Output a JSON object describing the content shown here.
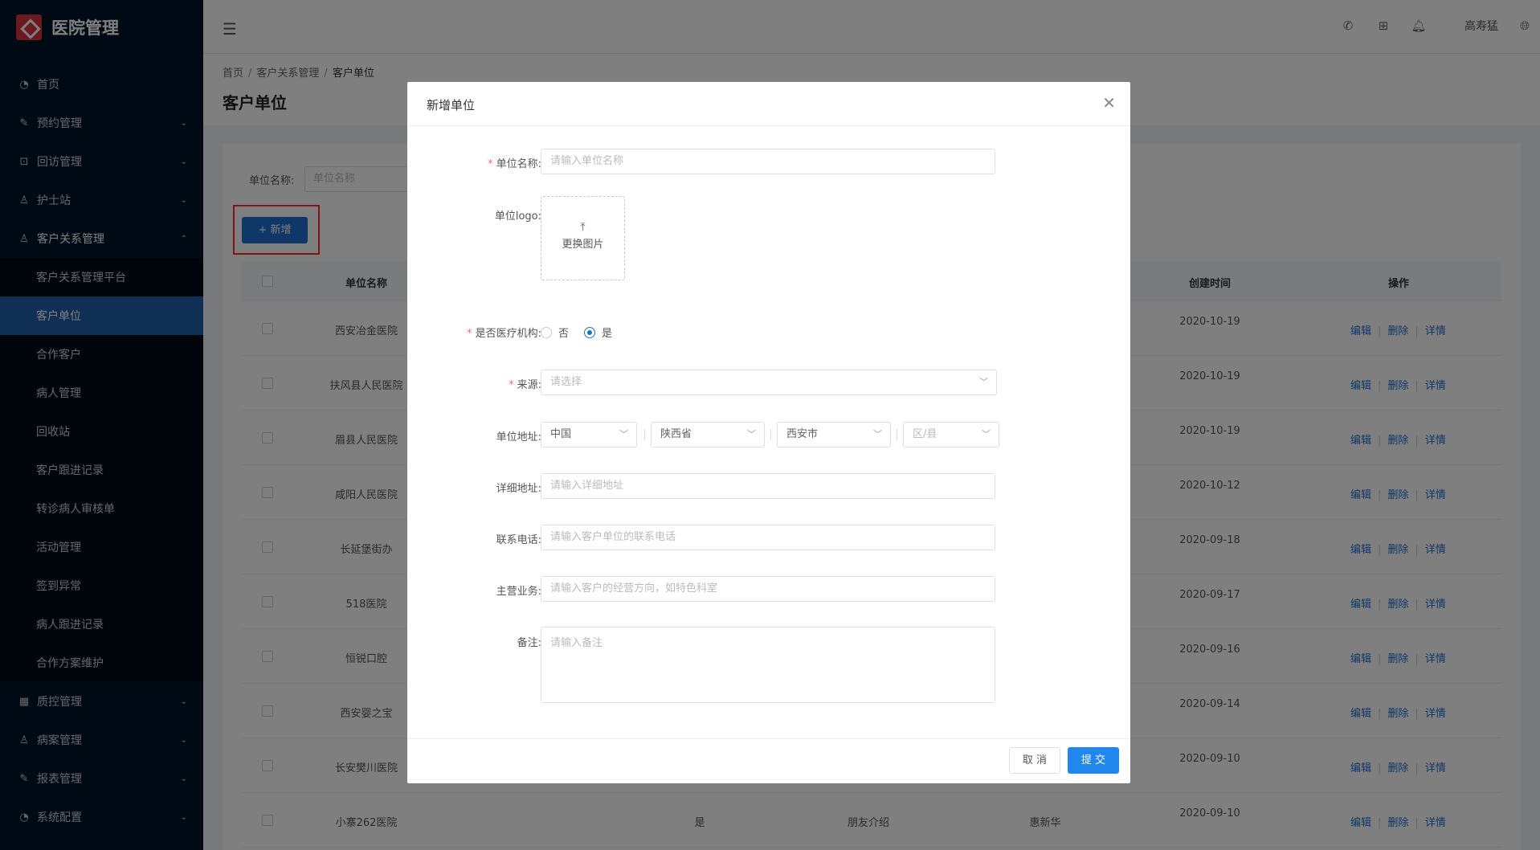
{
  "app": {
    "title": "医院管理"
  },
  "sidebar": {
    "items": [
      {
        "label": "首页",
        "icon": "dashboard-icon",
        "has_children": false
      },
      {
        "label": "预约管理",
        "icon": "edit-icon",
        "has_children": true
      },
      {
        "label": "回访管理",
        "icon": "lock-icon",
        "has_children": true
      },
      {
        "label": "护士站",
        "icon": "user-icon",
        "has_children": true
      },
      {
        "label": "客户关系管理",
        "icon": "user-icon",
        "has_children": true,
        "open": true
      }
    ],
    "submenu": [
      {
        "label": "客户关系管理平台",
        "active": false
      },
      {
        "label": "客户单位",
        "active": true
      },
      {
        "label": "合作客户",
        "active": false
      },
      {
        "label": "病人管理",
        "active": false
      },
      {
        "label": "回收站",
        "active": false
      },
      {
        "label": "客户跟进记录",
        "active": false
      },
      {
        "label": "转诊病人审核单",
        "active": false
      },
      {
        "label": "活动管理",
        "active": false
      },
      {
        "label": "签到异常",
        "active": false
      },
      {
        "label": "病人跟进记录",
        "active": false
      },
      {
        "label": "合作方案维护",
        "active": false
      }
    ],
    "bottom_items": [
      {
        "label": "质控管理",
        "icon": "table-icon"
      },
      {
        "label": "病案管理",
        "icon": "user-icon"
      },
      {
        "label": "报表管理",
        "icon": "edit-icon"
      },
      {
        "label": "系统配置",
        "icon": "dashboard-icon"
      }
    ]
  },
  "header": {
    "user": "高寿猛"
  },
  "breadcrumb": [
    "首页",
    "客户关系管理",
    "客户单位"
  ],
  "page": {
    "title": "客户单位",
    "filter_label": "单位名称:",
    "filter_placeholder": "单位名称",
    "add_label": "+ 新增"
  },
  "table": {
    "headers": {
      "name": "单位名称",
      "date": "创建时间",
      "ops": "操作"
    },
    "op_labels": {
      "edit": "编辑",
      "delete": "删除",
      "detail": "详情"
    },
    "rows": [
      {
        "name": "西安冶金医院",
        "med": "",
        "source": "",
        "contact": "",
        "date": "2020-10-19"
      },
      {
        "name": "扶风县人民医院",
        "med": "",
        "source": "",
        "contact": "",
        "date": "2020-10-19"
      },
      {
        "name": "眉县人民医院",
        "med": "",
        "source": "",
        "contact": "",
        "date": "2020-10-19"
      },
      {
        "name": "咸阳人民医院",
        "med": "",
        "source": "",
        "contact": "",
        "date": "2020-10-12"
      },
      {
        "name": "长延堡街办",
        "med": "",
        "source": "",
        "contact": "",
        "date": "2020-09-18"
      },
      {
        "name": "518医院",
        "med": "",
        "source": "",
        "contact": "",
        "date": "2020-09-17"
      },
      {
        "name": "恒锐口腔",
        "med": "",
        "source": "",
        "contact": "",
        "date": "2020-09-16"
      },
      {
        "name": "西安婴之宝",
        "med": "",
        "source": "",
        "contact": "",
        "date": "2020-09-14"
      },
      {
        "name": "长安樊川医院",
        "med": "",
        "source": "",
        "contact": "",
        "date": "2020-09-10"
      },
      {
        "name": "小寨262医院",
        "med": "是",
        "source": "朋友介绍",
        "contact": "惠新华",
        "date": "2020-09-10"
      }
    ]
  },
  "modal": {
    "title": "新增单位",
    "fields": {
      "name_label": "单位名称:",
      "name_placeholder": "请输入单位名称",
      "logo_label": "单位logo:",
      "logo_button": "更换图片",
      "medical_label": "是否医疗机构:",
      "medical_no": "否",
      "medical_yes": "是",
      "source_label": "来源:",
      "source_placeholder": "请选择",
      "address_label": "单位地址:",
      "country": "中国",
      "province": "陕西省",
      "city": "西安市",
      "district_placeholder": "区/县",
      "detail_label": "详细地址:",
      "detail_placeholder": "请输入详细地址",
      "phone_label": "联系电话:",
      "phone_placeholder": "请输入客户单位的联系电话",
      "business_label": "主营业务:",
      "business_placeholder": "请输入客户的经营方向，如特色科室",
      "remark_label": "备注:",
      "remark_placeholder": "请输入备注"
    },
    "cancel_label": "取 消",
    "submit_label": "提 交"
  },
  "colors": {
    "primary": "#1f6fd1",
    "sidebar_bg": "#001529",
    "highlight_border": "#ff2b2b"
  }
}
